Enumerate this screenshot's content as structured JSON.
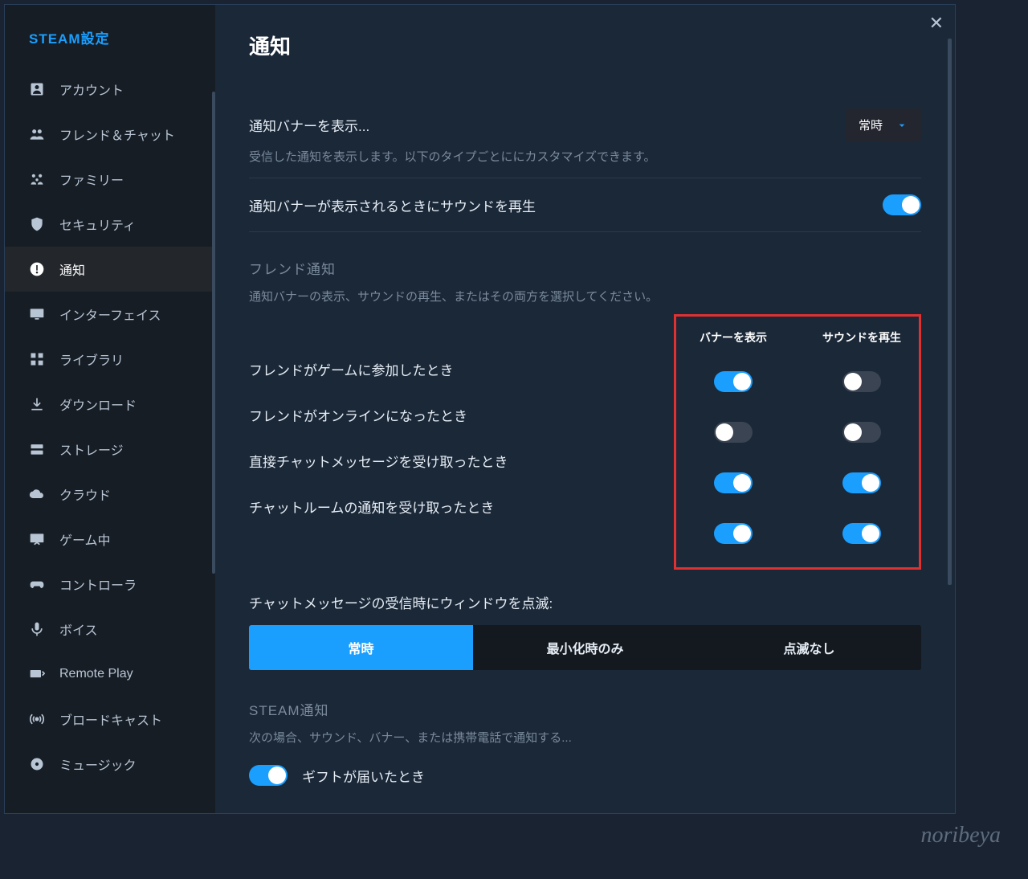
{
  "sidebar": {
    "title": "STEAM設定",
    "items": [
      {
        "label": "アカウント",
        "icon": "account"
      },
      {
        "label": "フレンド＆チャット",
        "icon": "friends"
      },
      {
        "label": "ファミリー",
        "icon": "family"
      },
      {
        "label": "セキュリティ",
        "icon": "shield"
      },
      {
        "label": "通知",
        "icon": "notification",
        "active": true
      },
      {
        "label": "インターフェイス",
        "icon": "monitor"
      },
      {
        "label": "ライブラリ",
        "icon": "library"
      },
      {
        "label": "ダウンロード",
        "icon": "download"
      },
      {
        "label": "ストレージ",
        "icon": "storage"
      },
      {
        "label": "クラウド",
        "icon": "cloud"
      },
      {
        "label": "ゲーム中",
        "icon": "ingame"
      },
      {
        "label": "コントローラ",
        "icon": "controller"
      },
      {
        "label": "ボイス",
        "icon": "mic"
      },
      {
        "label": "Remote Play",
        "icon": "remote"
      },
      {
        "label": "ブロードキャスト",
        "icon": "broadcast"
      },
      {
        "label": "ミュージック",
        "icon": "music"
      }
    ]
  },
  "main": {
    "title": "通知",
    "banner": {
      "label": "通知バナーを表示...",
      "selected": "常時",
      "desc": "受信した通知を表示します。以下のタイプごとににカスタマイズできます。"
    },
    "sound_row": {
      "label": "通知バナーが表示されるときにサウンドを再生",
      "on": true
    },
    "friend_section": {
      "title": "フレンド通知",
      "desc": "通知バナーの表示、サウンドの再生、またはその両方を選択してください。",
      "col1": "バナーを表示",
      "col2": "サウンドを再生",
      "rows": [
        {
          "label": "フレンドがゲームに参加したとき",
          "banner": true,
          "sound": false
        },
        {
          "label": "フレンドがオンラインになったとき",
          "banner": false,
          "sound": false
        },
        {
          "label": "直接チャットメッセージを受け取ったとき",
          "banner": true,
          "sound": true
        },
        {
          "label": "チャットルームの通知を受け取ったとき",
          "banner": true,
          "sound": true
        }
      ]
    },
    "flash": {
      "label": "チャットメッセージの受信時にウィンドウを点滅:",
      "options": [
        "常時",
        "最小化時のみ",
        "点滅なし"
      ],
      "active": 0
    },
    "steam_notif": {
      "title": "STEAM通知",
      "desc": "次の場合、サウンド、バナー、または携帯電話で通知する..."
    },
    "gift": {
      "label": "ギフトが届いたとき",
      "on": true
    }
  },
  "watermark": "noribeya"
}
